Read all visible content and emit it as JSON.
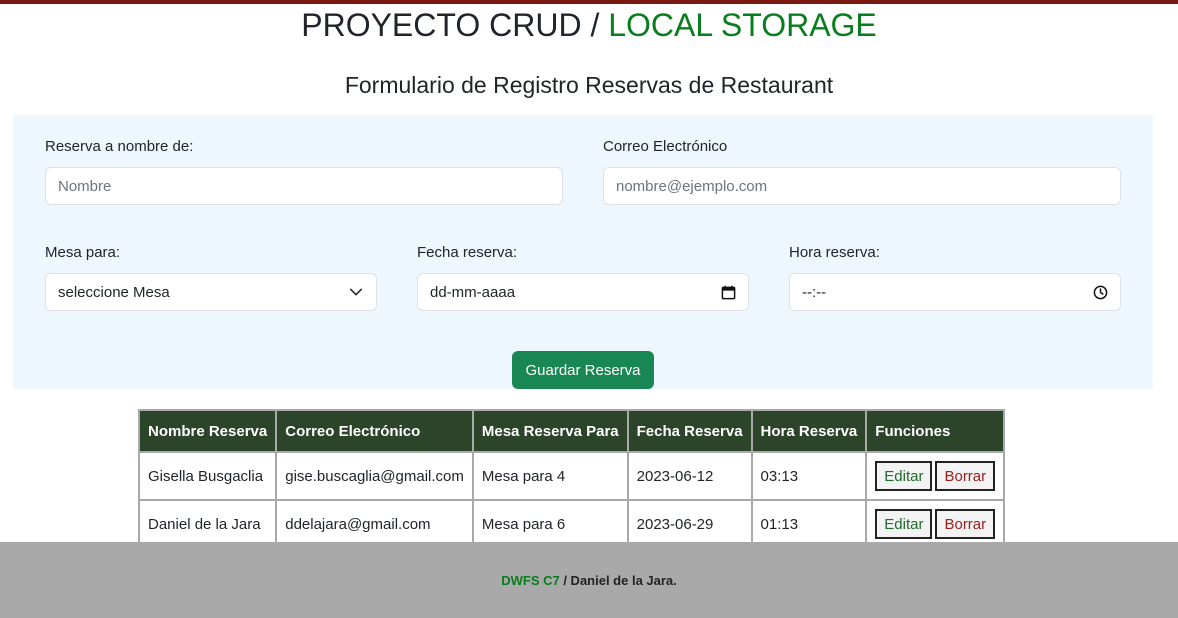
{
  "header": {
    "title_main": "PROYECTO CRUD /",
    "title_accent": "LOCAL STORAGE",
    "form_title": "Formulario de Registro Reservas de Restaurant"
  },
  "form": {
    "name_label": "Reserva a nombre de:",
    "name_placeholder": "Nombre",
    "email_label": "Correo Electrónico",
    "email_placeholder": "nombre@ejemplo.com",
    "table_label": "Mesa para:",
    "table_selected": "seleccione Mesa",
    "date_label": "Fecha reserva:",
    "date_value": "dd-mm-aaaa",
    "time_label": "Hora reserva:",
    "time_value": "--:--",
    "save_label": "Guardar Reserva"
  },
  "table": {
    "headers": [
      "Nombre Reserva",
      "Correo Electrónico",
      "Mesa Reserva Para",
      "Fecha Reserva",
      "Hora Reserva",
      "Funciones"
    ],
    "rows": [
      {
        "name": "Gisella Busgaclia",
        "email": "gise.buscaglia@gmail.com",
        "table": "Mesa para 4",
        "date": "2023-06-12",
        "time": "03:13"
      },
      {
        "name": "Daniel de la Jara",
        "email": "ddelajara@gmail.com",
        "table": "Mesa para 6",
        "date": "2023-06-29",
        "time": "01:13"
      }
    ],
    "edit_label": "Editar",
    "delete_label": "Borrar"
  },
  "footer": {
    "accent": "DWFS C7",
    "text": " / Daniel de la Jara."
  },
  "colors": {
    "accent_green": "#0a7d1e",
    "table_header": "#2c4429",
    "save_button": "#198754",
    "panel_bg": "#eef6fe",
    "footer_bg": "#a9a9a9"
  },
  "icons": {
    "select": "chevron-down-icon",
    "date": "calendar-icon",
    "time": "clock-icon"
  }
}
